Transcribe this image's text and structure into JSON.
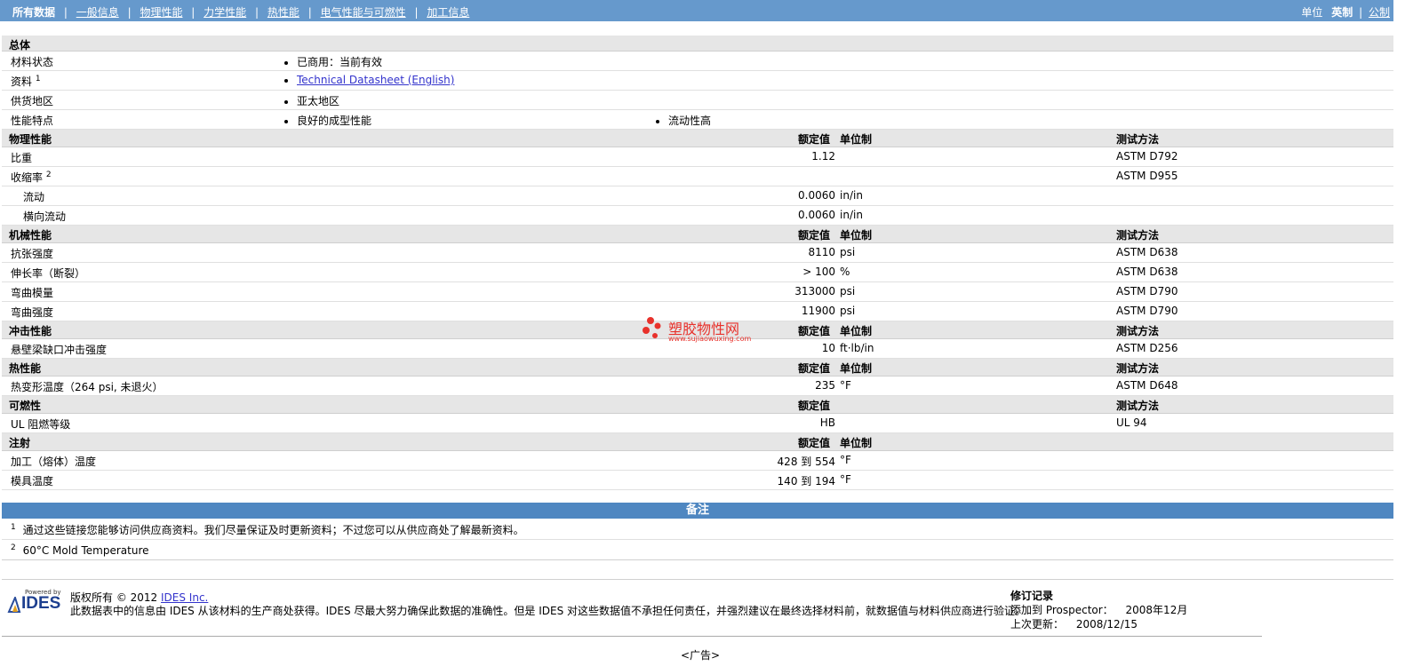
{
  "topnav": {
    "items": [
      "所有数据",
      "一般信息",
      "物理性能",
      "力学性能",
      "热性能",
      "电气性能与可燃性",
      "加工信息"
    ],
    "separator": "|",
    "units_label": "单位",
    "units_selected": "英制",
    "units_other": "公制"
  },
  "general": {
    "title": "总体",
    "material_status_label": "材料状态",
    "material_status_value": "已商用：当前有效",
    "data_label": "资料",
    "data_label_sup": "1",
    "data_link": "Technical Datasheet (English)",
    "supply_label": "供货地区",
    "supply_value": "亚太地区",
    "features_label": "性能特点",
    "feature1": "良好的成型性能",
    "feature2": "流动性高"
  },
  "headers": {
    "rated": "额定值",
    "unit": "单位制",
    "test": "测试方法"
  },
  "physical": {
    "title": "物理性能",
    "rows": [
      {
        "label": "比重",
        "sup": "",
        "value": "1.12",
        "unit": "",
        "test": "ASTM D792"
      },
      {
        "label": "收缩率",
        "sup": "2",
        "value": "",
        "unit": "",
        "test": "ASTM D955"
      },
      {
        "label": "流动",
        "sup": "",
        "value": "0.0060",
        "unit": "in/in",
        "test": ""
      },
      {
        "label": "横向流动",
        "sup": "",
        "value": "0.0060",
        "unit": "in/in",
        "test": ""
      }
    ]
  },
  "mechanical": {
    "title": "机械性能",
    "rows": [
      {
        "label": "抗张强度",
        "value": "8110",
        "unit": "psi",
        "test": "ASTM D638"
      },
      {
        "label": "伸长率（断裂）",
        "value": "> 100",
        "unit": "%",
        "test": "ASTM D638"
      },
      {
        "label": "弯曲模量",
        "value": "313000",
        "unit": "psi",
        "test": "ASTM D790"
      },
      {
        "label": "弯曲强度",
        "value": "11900",
        "unit": "psi",
        "test": "ASTM D790"
      }
    ]
  },
  "impact": {
    "title": "冲击性能",
    "rows": [
      {
        "label": "悬壁梁缺口冲击强度",
        "value": "10",
        "unit": "ft·lb/in",
        "test": "ASTM D256"
      }
    ]
  },
  "thermal": {
    "title": "热性能",
    "rows": [
      {
        "label": "热变形温度（264 psi, 未退火）",
        "value": "235",
        "unit": "°F",
        "test": "ASTM D648"
      }
    ]
  },
  "flammability": {
    "title": "可燃性",
    "rows": [
      {
        "label": "UL 阻燃等级",
        "value": "HB",
        "unit": "",
        "test": "UL 94"
      }
    ]
  },
  "injection": {
    "title": "注射",
    "rows": [
      {
        "label": "加工（熔体）温度",
        "value": "428 到 554",
        "unit": "°F",
        "test": ""
      },
      {
        "label": "模具温度",
        "value": "140 到 194",
        "unit": "°F",
        "test": ""
      }
    ]
  },
  "watermark": {
    "title": "塑胶物性网",
    "url": "www.sujiaowuxing.com"
  },
  "notes": {
    "title": "备注",
    "items": [
      {
        "num": "1",
        "text": "通过这些链接您能够访问供应商资料。我们尽量保证及时更新资料；不过您可以从供应商处了解最新资料。"
      },
      {
        "num": "2",
        "text": "60°C Mold Temperature"
      }
    ]
  },
  "footer": {
    "powered_by": "Powered by",
    "logo_text": "IDES",
    "copyright": "版权所有 © 2012",
    "copyright_link": "IDES Inc.",
    "disclaimer": "此数据表中的信息由 IDES 从该材料的生产商处获得。IDES 尽最大努力确保此数据的准确性。但是 IDES 对这些数据值不承担任何责任，并强烈建议在最终选择材料前，就数据值与材料供应商进行验证。",
    "revision_title": "修订记录",
    "added_label": "添加到 Prospector：",
    "added_value": "2008年12月",
    "updated_label": "上次更新：",
    "updated_value": "2008/12/15",
    "ad_label": "<广告>"
  }
}
